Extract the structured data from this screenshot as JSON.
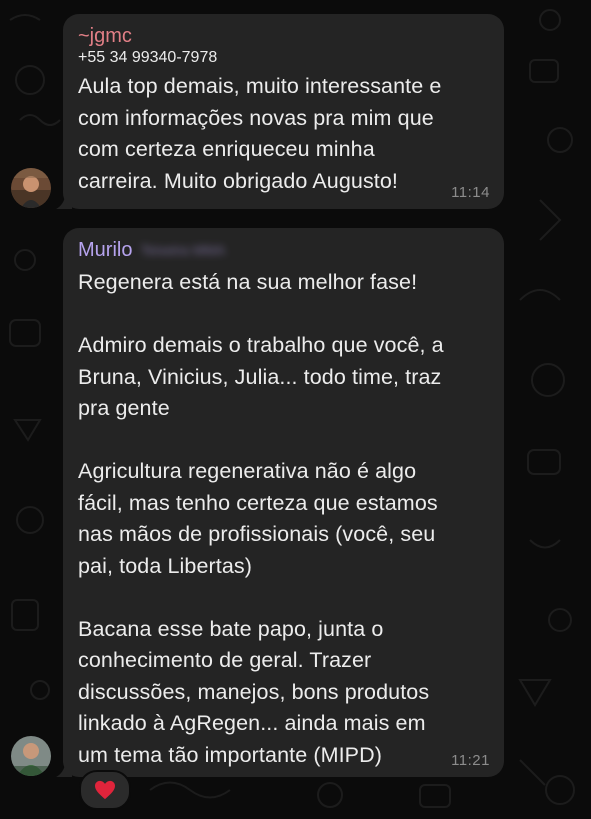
{
  "messages": [
    {
      "sender": "~jgmc",
      "sender_suffix": "",
      "phone": "+55 34 99340-7978",
      "text": "Aula top demais, muito interessante e\ncom informações novas pra mim que\ncom certeza enriqueceu minha\ncarreira. Muito obrigado Augusto!",
      "time": "11:14",
      "avatar": "user-photo-avatar"
    },
    {
      "sender": "Murilo",
      "sender_suffix": "Teixeira MMA",
      "text": "Regenera está na sua melhor fase!\n\nAdmiro demais o trabalho que você, a\nBruna, Vinicius, Julia... todo time, traz\npra gente\n\nAgricultura regenerativa não é algo\nfácil, mas tenho certeza que estamos\nnas mãos de profissionais (você, seu\npai, toda Libertas)\n\nBacana esse bate papo, junta o\nconhecimento de geral. Trazer\ndiscussões, manejos, bons produtos\nlinkado à AgRegen... ainda mais em\num tema tão importante (MIPD)",
      "time": "11:21",
      "avatar": "user-photo-avatar",
      "reaction": "heart"
    }
  ],
  "colors": {
    "background": "#0b0b0b",
    "bubble": "#242424",
    "sender_1": "#e17f86",
    "sender_2": "#b6a3ee",
    "reaction_heart": "#e0243b"
  }
}
